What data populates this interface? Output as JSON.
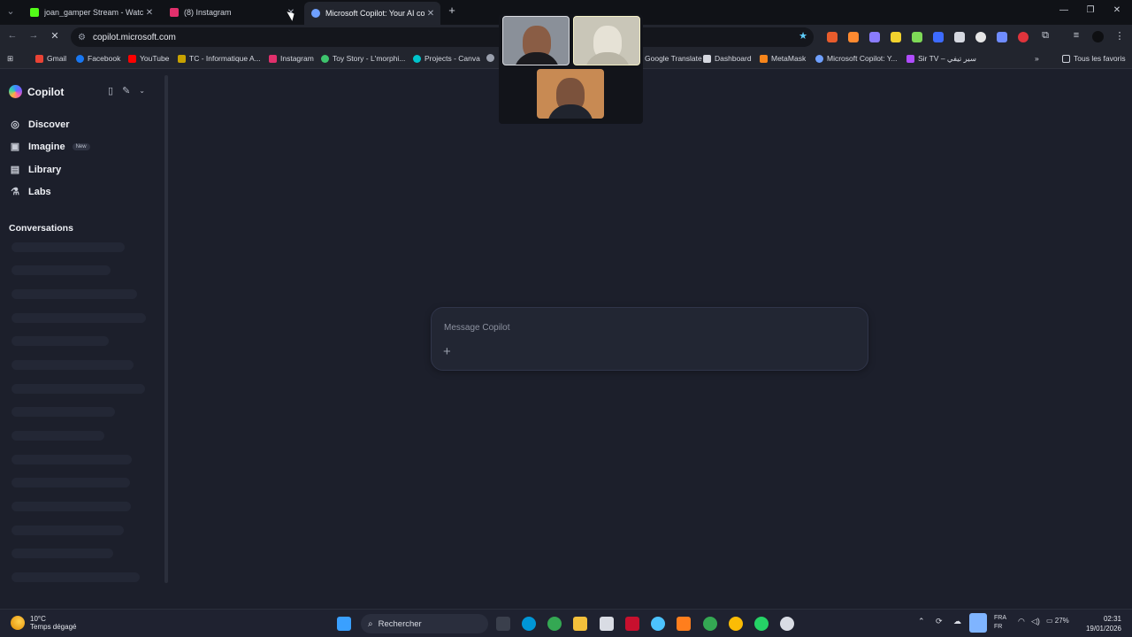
{
  "browser": {
    "tabs": [
      {
        "title": "joan_gamper Stream - Watch Li",
        "icon": "kick-icon",
        "color": "#53fc18"
      },
      {
        "title": "(8) Instagram",
        "icon": "instagram-icon",
        "color": "#e1306c"
      },
      {
        "title": "Microsoft Copilot: Your AI com",
        "icon": "copilot-icon",
        "color": "#6fa0ff"
      }
    ],
    "url": "copilot.microsoft.com",
    "bookmarks": [
      "Gmail",
      "Facebook",
      "YouTube",
      "TC - Informatique A...",
      "Instagram",
      "Toy Story - L'morphi...",
      "Projects - Canva",
      "Google Translate",
      "Dashboard",
      "MetaMask",
      "Microsoft Copilot: Y...",
      "Sir TV – سير تيفي"
    ],
    "all_bookmarks": "Tous les favoris"
  },
  "sidebar": {
    "brand": "Copilot",
    "nav": [
      {
        "label": "Discover",
        "icon": "compass-icon"
      },
      {
        "label": "Imagine",
        "icon": "image-icon",
        "badge": "New"
      },
      {
        "label": "Library",
        "icon": "library-icon"
      },
      {
        "label": "Labs",
        "icon": "flask-icon"
      }
    ],
    "conversations_title": "Conversations"
  },
  "composer": {
    "placeholder": "Message Copilot"
  },
  "taskbar": {
    "weather_temp": "10°C",
    "weather_desc": "Temps dégagé",
    "search_label": "Rechercher",
    "lang_1": "FRA",
    "lang_2": "FR",
    "battery": "27%",
    "time": "02:31",
    "date": "19/01/2026"
  },
  "colors": {
    "background": "#1c1f2b",
    "chrome": "#22252e"
  }
}
